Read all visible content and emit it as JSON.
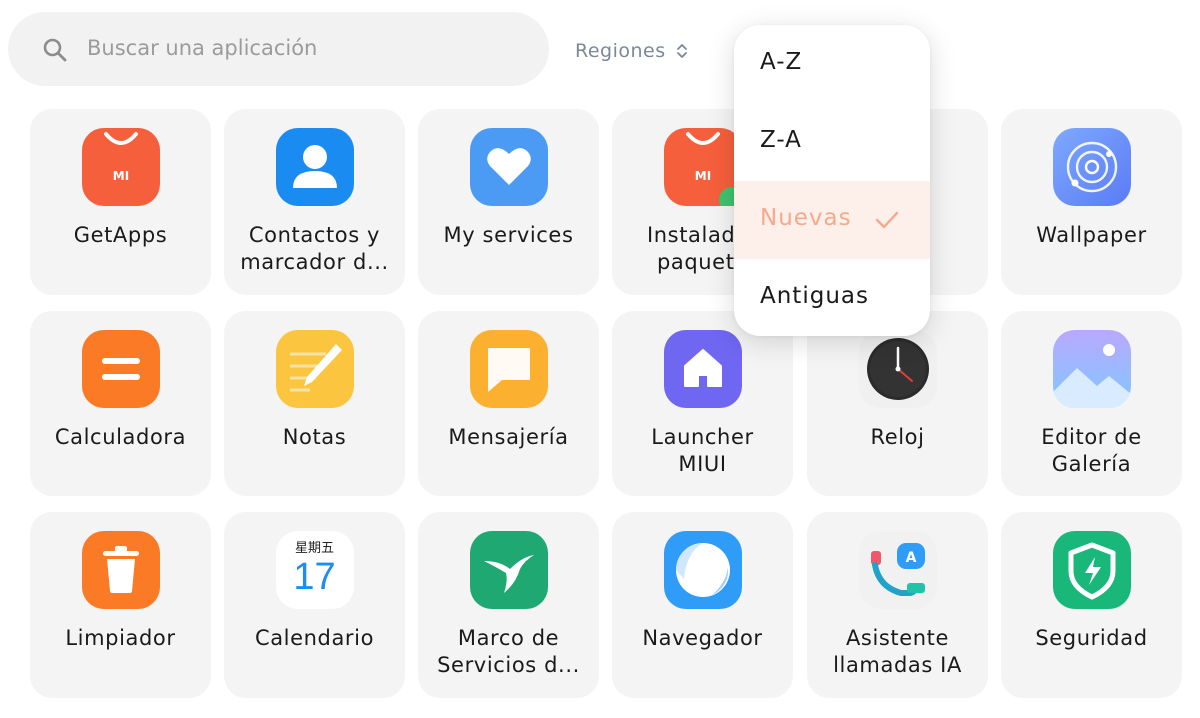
{
  "search": {
    "placeholder": "Buscar una aplicación",
    "icon": "search-icon"
  },
  "filter": {
    "label": "Regiones",
    "icon": "sort-arrows-icon"
  },
  "sort_menu": {
    "items": [
      {
        "label": "A-Z",
        "selected": false
      },
      {
        "label": "Z-A",
        "selected": false
      },
      {
        "label": "Nuevas",
        "selected": true
      },
      {
        "label": "Antiguas",
        "selected": false
      }
    ],
    "selected_color": "#f6a98b",
    "selected_bg": "#fdf0ea"
  },
  "apps": [
    {
      "label": "GetApps",
      "icon": "getapps-icon"
    },
    {
      "label": "Contactos y\nmarcador d...",
      "icon": "contacts-icon"
    },
    {
      "label": "My services",
      "icon": "heart-icon"
    },
    {
      "label": "Instalador\npaquete",
      "icon": "package-installer-icon"
    },
    {
      "label": "",
      "icon": ""
    },
    {
      "label": "Wallpaper",
      "icon": "wallpaper-icon"
    },
    {
      "label": "Calculadora",
      "icon": "calculator-icon"
    },
    {
      "label": "Notas",
      "icon": "notes-icon"
    },
    {
      "label": "Mensajería",
      "icon": "messaging-icon"
    },
    {
      "label": "Launcher\nMIUI",
      "icon": "home-icon"
    },
    {
      "label": "Reloj",
      "icon": "clock-icon"
    },
    {
      "label": "Editor de\nGalería",
      "icon": "gallery-editor-icon"
    },
    {
      "label": "Limpiador",
      "icon": "trash-icon"
    },
    {
      "label": "Calendario",
      "icon": "calendar-icon",
      "day_name": "星期五",
      "day_number": "17"
    },
    {
      "label": "Marco de\nServicios d...",
      "icon": "hummingbird-icon"
    },
    {
      "label": "Navegador",
      "icon": "browser-icon"
    },
    {
      "label": "Asistente\nllamadas IA",
      "icon": "ai-call-icon"
    },
    {
      "label": "Seguridad",
      "icon": "security-shield-icon"
    }
  ]
}
